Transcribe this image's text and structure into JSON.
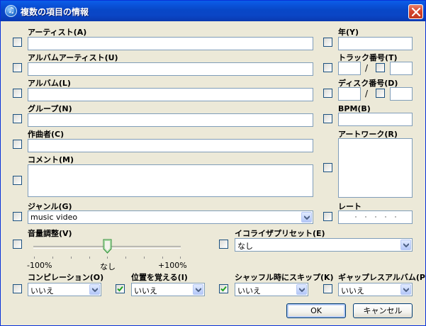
{
  "window": {
    "title": "複数の項目の情報",
    "app_icon": "itunes-icon",
    "close_icon": "close-icon"
  },
  "fields": {
    "artist": {
      "label": "アーティスト(A)",
      "value": "",
      "checked": false
    },
    "album_artist": {
      "label": "アルバムアーティスト(U)",
      "value": "",
      "checked": false
    },
    "album": {
      "label": "アルバム(L)",
      "value": "",
      "checked": false
    },
    "grouping": {
      "label": "グループ(N)",
      "value": "",
      "checked": false
    },
    "composer": {
      "label": "作曲者(C)",
      "value": "",
      "checked": false
    },
    "comment": {
      "label": "コメント(M)",
      "value": "",
      "checked": false
    },
    "genre": {
      "label": "ジャンル(G)",
      "value": "music video",
      "checked": false
    },
    "volume": {
      "label": "音量調整(V)",
      "min_label": "-100%",
      "mid_label": "なし",
      "max_label": "+100%",
      "value_percent": 0,
      "checked": false
    },
    "year": {
      "label": "年(Y)",
      "value": "",
      "checked": false
    },
    "track": {
      "label": "トラック番号(T)",
      "number": "",
      "separator": "/",
      "total": "",
      "checked": false,
      "total_checked": false
    },
    "disc": {
      "label": "ディスク番号(D)",
      "number": "",
      "separator": "/",
      "total": "",
      "checked": false,
      "total_checked": false
    },
    "bpm": {
      "label": "BPM(B)",
      "value": "",
      "checked": false
    },
    "artwork": {
      "label": "アートワーク(R)",
      "checked": false
    },
    "rating": {
      "label": "レート",
      "stars": 0,
      "checked": false
    },
    "equalizer": {
      "label": "イコライザプリセット(E)",
      "value": "なし",
      "checked": false
    },
    "compilation": {
      "label": "コンピレーション(O)",
      "value": "いいえ",
      "checked": false
    },
    "remember_position": {
      "label": "位置を覚える(I)",
      "value": "いいえ",
      "checked": true
    },
    "skip_shuffle": {
      "label": "シャッフル時にスキップ(K)",
      "value": "いいえ",
      "checked": true
    },
    "gapless": {
      "label": "ギャップレスアルバム(P)",
      "value": "いいえ",
      "checked": false
    }
  },
  "buttons": {
    "ok": "OK",
    "cancel": "キャンセル"
  }
}
